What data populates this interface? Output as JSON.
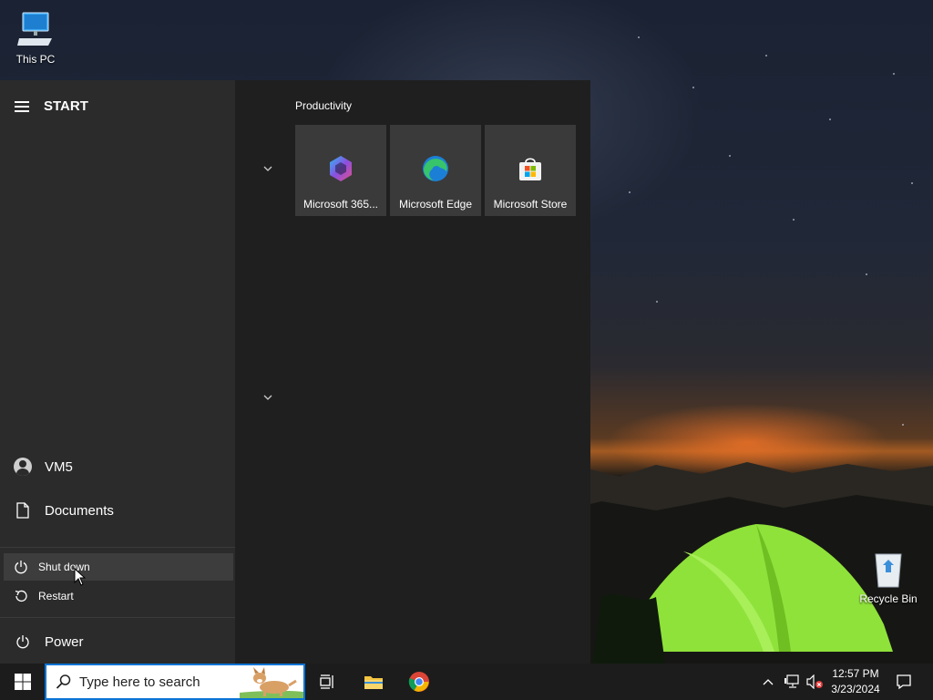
{
  "desktop": {
    "icons": [
      {
        "label": "This PC",
        "icon": "computer-icon"
      },
      {
        "label": "Recycle Bin",
        "icon": "recycle-bin-icon"
      }
    ]
  },
  "start": {
    "header_label": "START",
    "user_name": "VM5",
    "documents_label": "Documents",
    "power_label": "Power",
    "power_menu": {
      "shut_down": "Shut down",
      "restart": "Restart"
    },
    "group_title": "Productivity",
    "tiles": [
      {
        "label": "Microsoft 365...",
        "icon": "microsoft-365-icon"
      },
      {
        "label": "Microsoft Edge",
        "icon": "edge-icon"
      },
      {
        "label": "Microsoft Store",
        "icon": "store-icon"
      }
    ]
  },
  "taskbar": {
    "search_placeholder": "Type here to search",
    "time": "12:57 PM",
    "date": "3/23/2024"
  },
  "colors": {
    "taskbar_bg": "#1c1c1c",
    "start_left_bg": "#2b2b2b",
    "start_right_bg": "#1f1f1f",
    "tile_bg": "#3a3a3a",
    "accent": "#0a74d6"
  }
}
